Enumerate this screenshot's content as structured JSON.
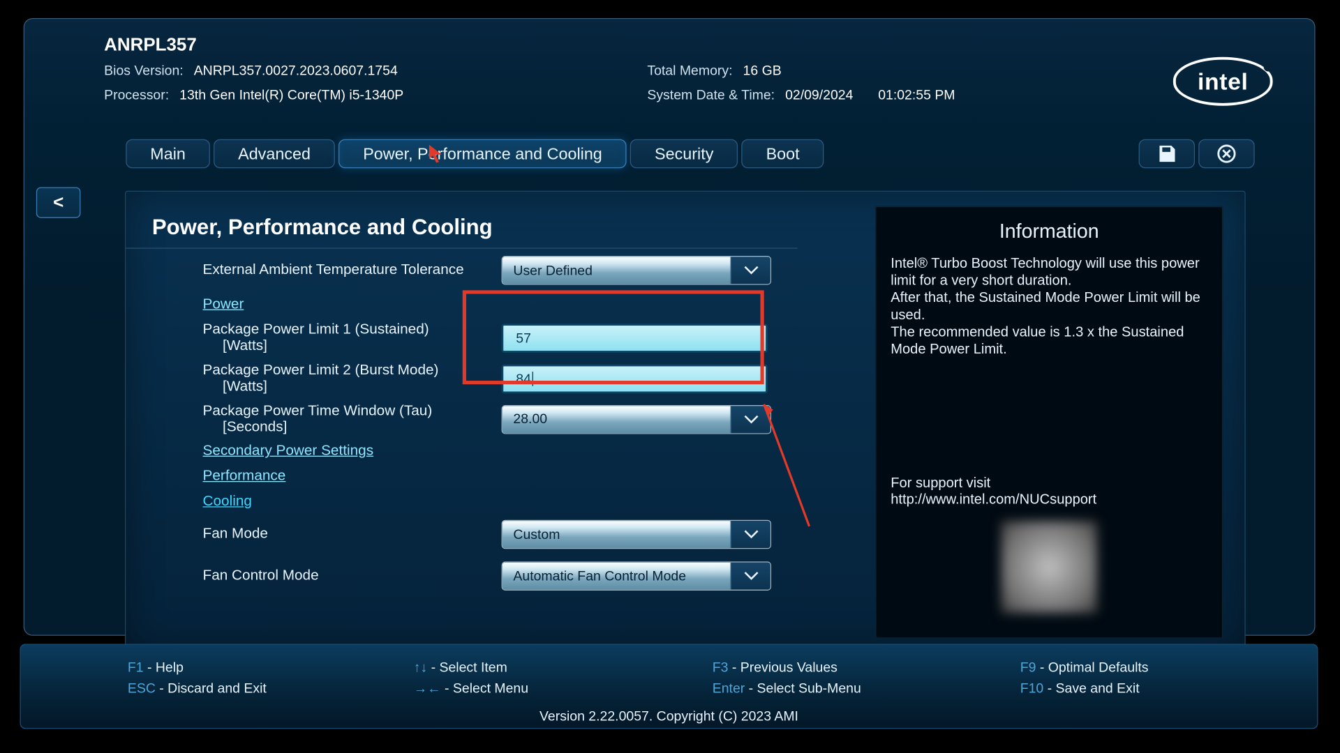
{
  "header": {
    "board_name": "ANRPL357",
    "bios_label": "Bios Version:",
    "bios_value": "ANRPL357.0027.2023.0607.1754",
    "proc_label": "Processor:",
    "proc_value": "13th Gen Intel(R) Core(TM) i5-1340P",
    "mem_label": "Total Memory:",
    "mem_value": "16 GB",
    "dt_label": "System Date & Time:",
    "date_value": "02/09/2024",
    "time_value": "01:02:55 PM",
    "logo_text": "intel"
  },
  "tabs": {
    "main": "Main",
    "advanced": "Advanced",
    "ppc": "Power, Performance and Cooling",
    "security": "Security",
    "boot": "Boot"
  },
  "back_chevron": "<",
  "page_title": "Power, Performance and Cooling",
  "fields": {
    "ambient_label": "External Ambient Temperature Tolerance",
    "ambient_value": "User Defined",
    "power_link": "Power",
    "pl1_label": "Package Power Limit 1 (Sustained)",
    "pl1_sub": "[Watts]",
    "pl1_value": "57",
    "pl2_label": "Package Power Limit 2 (Burst Mode)",
    "pl2_sub": "[Watts]",
    "pl2_value": "84",
    "tau_label": "Package Power Time Window (Tau)",
    "tau_sub": "[Seconds]",
    "tau_value": "28.00",
    "sec_power_link": "Secondary Power Settings",
    "perf_link": "Performance",
    "cool_link": "Cooling",
    "fan_mode_label": "Fan Mode",
    "fan_mode_value": "Custom",
    "fan_ctrl_label": "Fan Control Mode",
    "fan_ctrl_value": "Automatic Fan Control Mode"
  },
  "info": {
    "title": "Information",
    "body1": "Intel® Turbo Boost Technology will use this power limit for a very short duration.",
    "body2": "After that, the Sustained Mode Power Limit will be used.",
    "body3": "The recommended value is 1.3 x the Sustained Mode Power Limit.",
    "support1": "For support visit",
    "support2": "http://www.intel.com/NUCsupport"
  },
  "footer": {
    "f1": "F1",
    "f1t": " - Help",
    "esc": "ESC",
    "esct": " - Discard and Exit",
    "ud": "↑↓",
    "udt": " - Select Item",
    "lr": "→←",
    "lrt": " - Select Menu",
    "f3": "F3",
    "f3t": " - Previous Values",
    "enter": "Enter",
    "entert": " - Select Sub-Menu",
    "f9": "F9",
    "f9t": " - Optimal Defaults",
    "f10": "F10",
    "f10t": " - Save and Exit",
    "version": "Version 2.22.0057. Copyright (C) 2023 AMI"
  }
}
